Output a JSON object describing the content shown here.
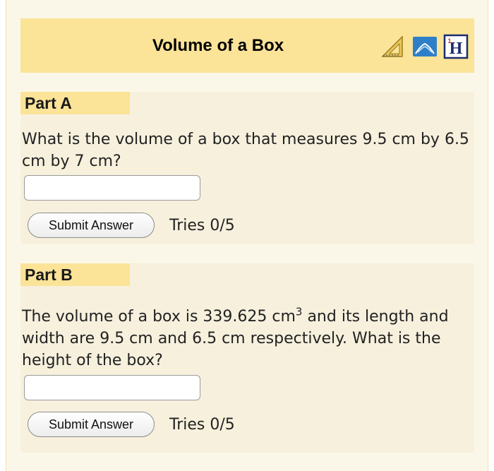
{
  "header": {
    "title": "Volume of a Box",
    "icons": [
      "protractor-ruler-icon",
      "book-icon",
      "hint-h-icon"
    ]
  },
  "partA": {
    "label": "Part A",
    "question": "What is the volume of a box that measures 9.5 cm by 6.5 cm by 7 cm?",
    "input_value": "",
    "submit_label": "Submit Answer",
    "tries": "Tries 0/5"
  },
  "partB": {
    "label": "Part B",
    "question_before": "The volume of a box is 339.625 cm",
    "question_sup": "3",
    "question_after": " and its length and width are 9.5 cm and 6.5 cm respectively. What is the height of the box?",
    "input_value": "",
    "submit_label": "Submit Answer",
    "tries": "Tries 0/5"
  },
  "colors": {
    "header_bg": "#fbe398",
    "panel_bg": "#f6f0dd",
    "frame_bg": "#fbf7e8"
  }
}
